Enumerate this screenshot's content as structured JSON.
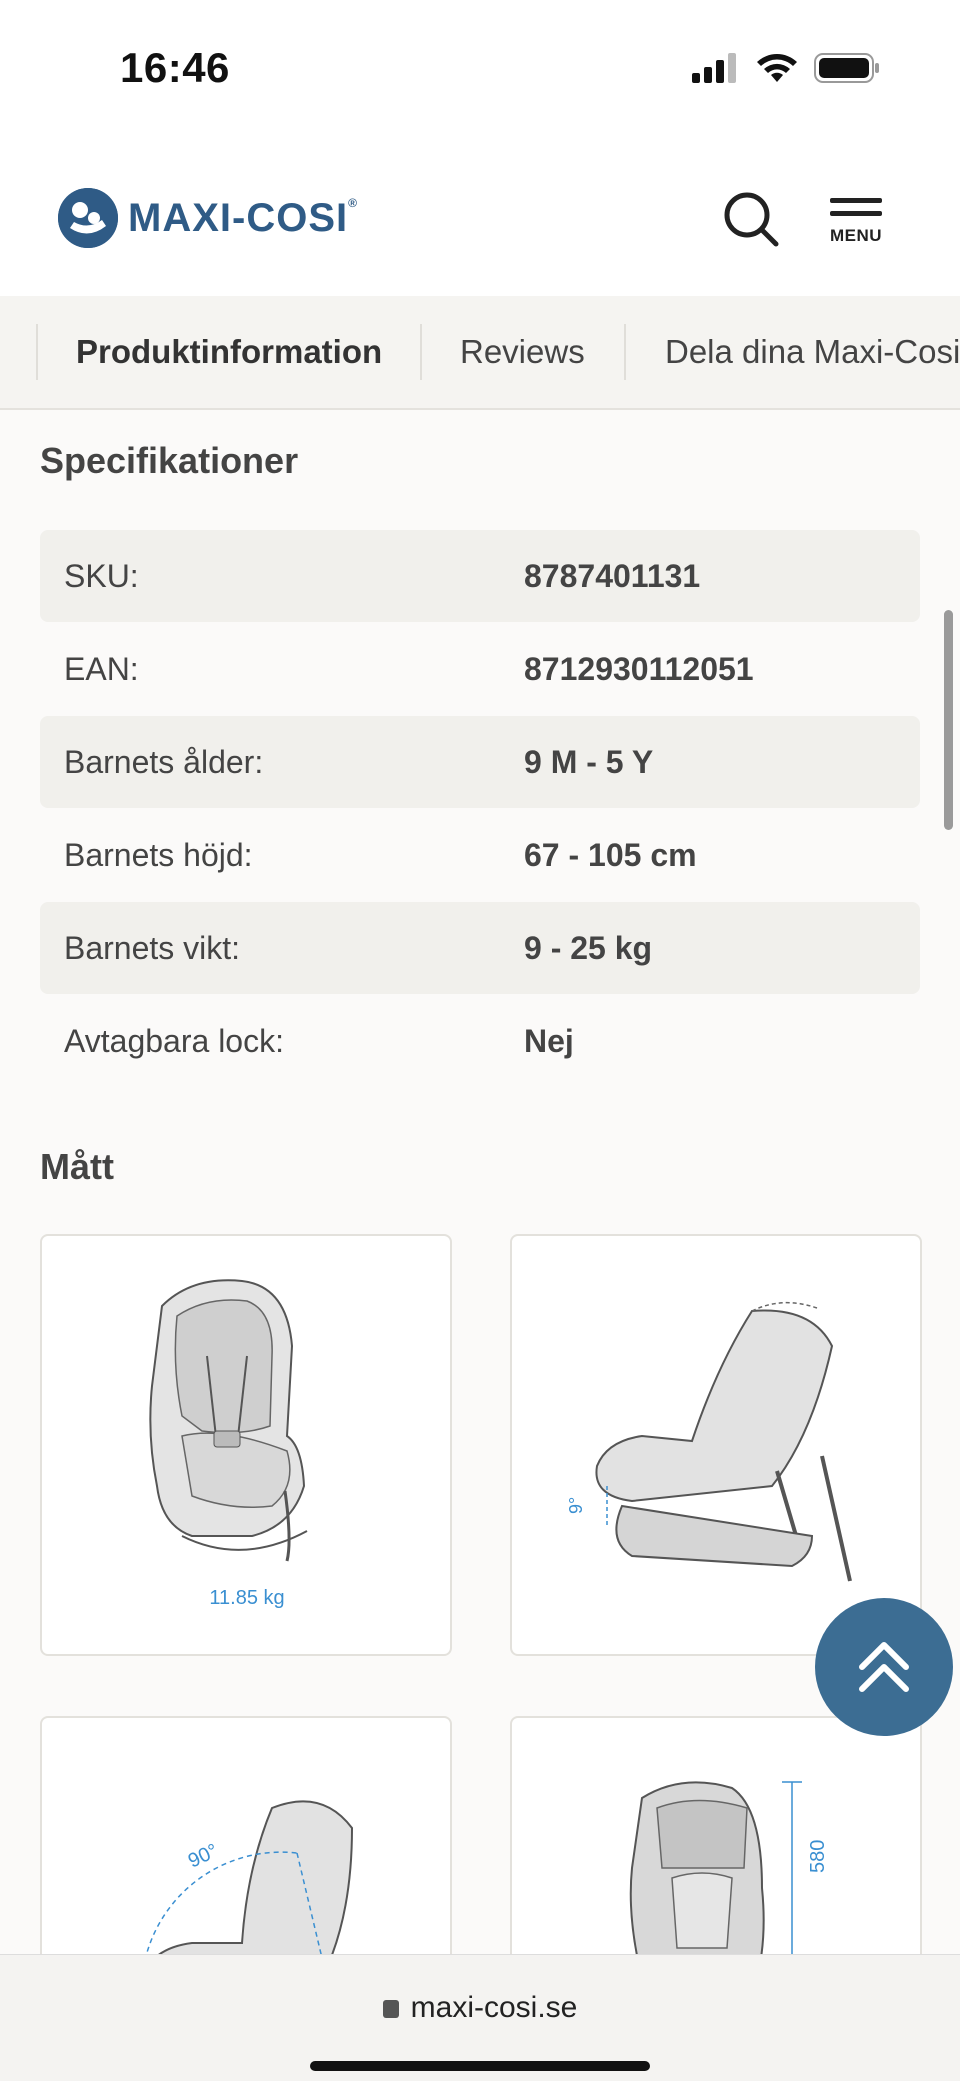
{
  "status_bar": {
    "time": "16:46"
  },
  "header": {
    "brand": "MAXI-COSI",
    "brand_mark": "®",
    "menu_label": "MENU"
  },
  "tabs": [
    {
      "label": "Produktinformation",
      "active": true
    },
    {
      "label": "Reviews",
      "active": false
    },
    {
      "label": "Dela dina Maxi-Cosi",
      "active": false
    }
  ],
  "specs": {
    "title": "Specifikationer",
    "rows": [
      {
        "label": "SKU:",
        "value": "8787401131"
      },
      {
        "label": "EAN:",
        "value": "8712930112051"
      },
      {
        "label": "Barnets ålder:",
        "value": "9 M - 5 Y"
      },
      {
        "label": "Barnets höjd:",
        "value": "67 - 105 cm"
      },
      {
        "label": "Barnets vikt:",
        "value": "9 - 25 kg"
      },
      {
        "label": "Avtagbara lock:",
        "value": "Nej"
      }
    ]
  },
  "dimensions": {
    "title": "Mått",
    "images": [
      {
        "caption": "11.85 kg"
      },
      {
        "caption": "9°"
      },
      {
        "caption": "90°"
      },
      {
        "caption": "580"
      }
    ]
  },
  "url_bar": {
    "domain": "maxi-cosi.se"
  },
  "colors": {
    "brand": "#2f5b86",
    "button": "#3c6d93",
    "diagram_text": "#3a8fd1"
  }
}
